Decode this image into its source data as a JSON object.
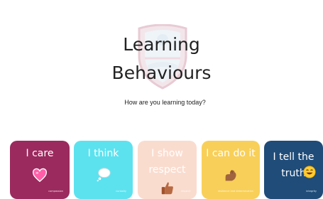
{
  "page": {
    "title_line1": "Learning",
    "title_line2": "Behaviours",
    "subtitle": "How are you learning today?"
  },
  "cards": [
    {
      "label": "I care",
      "icon": "heart-icon",
      "color": "#9b2a5e",
      "footnote": "compassion"
    },
    {
      "label": "I think",
      "icon": "thought-bubble-icon",
      "color": "#5ce2ef",
      "footnote": "curiosity"
    },
    {
      "label": "I show\nrespect",
      "icon": "thumbs-up-icon",
      "color": "#fadccf",
      "footnote": "respect"
    },
    {
      "label": "I can do it",
      "icon": "flexed-arm-icon",
      "color": "#f8cf58",
      "footnote": "resilience and determination"
    },
    {
      "label": "I tell the\ntruth",
      "icon": "smiley-icon",
      "color": "#1f4c79",
      "footnote": "integrity"
    }
  ]
}
